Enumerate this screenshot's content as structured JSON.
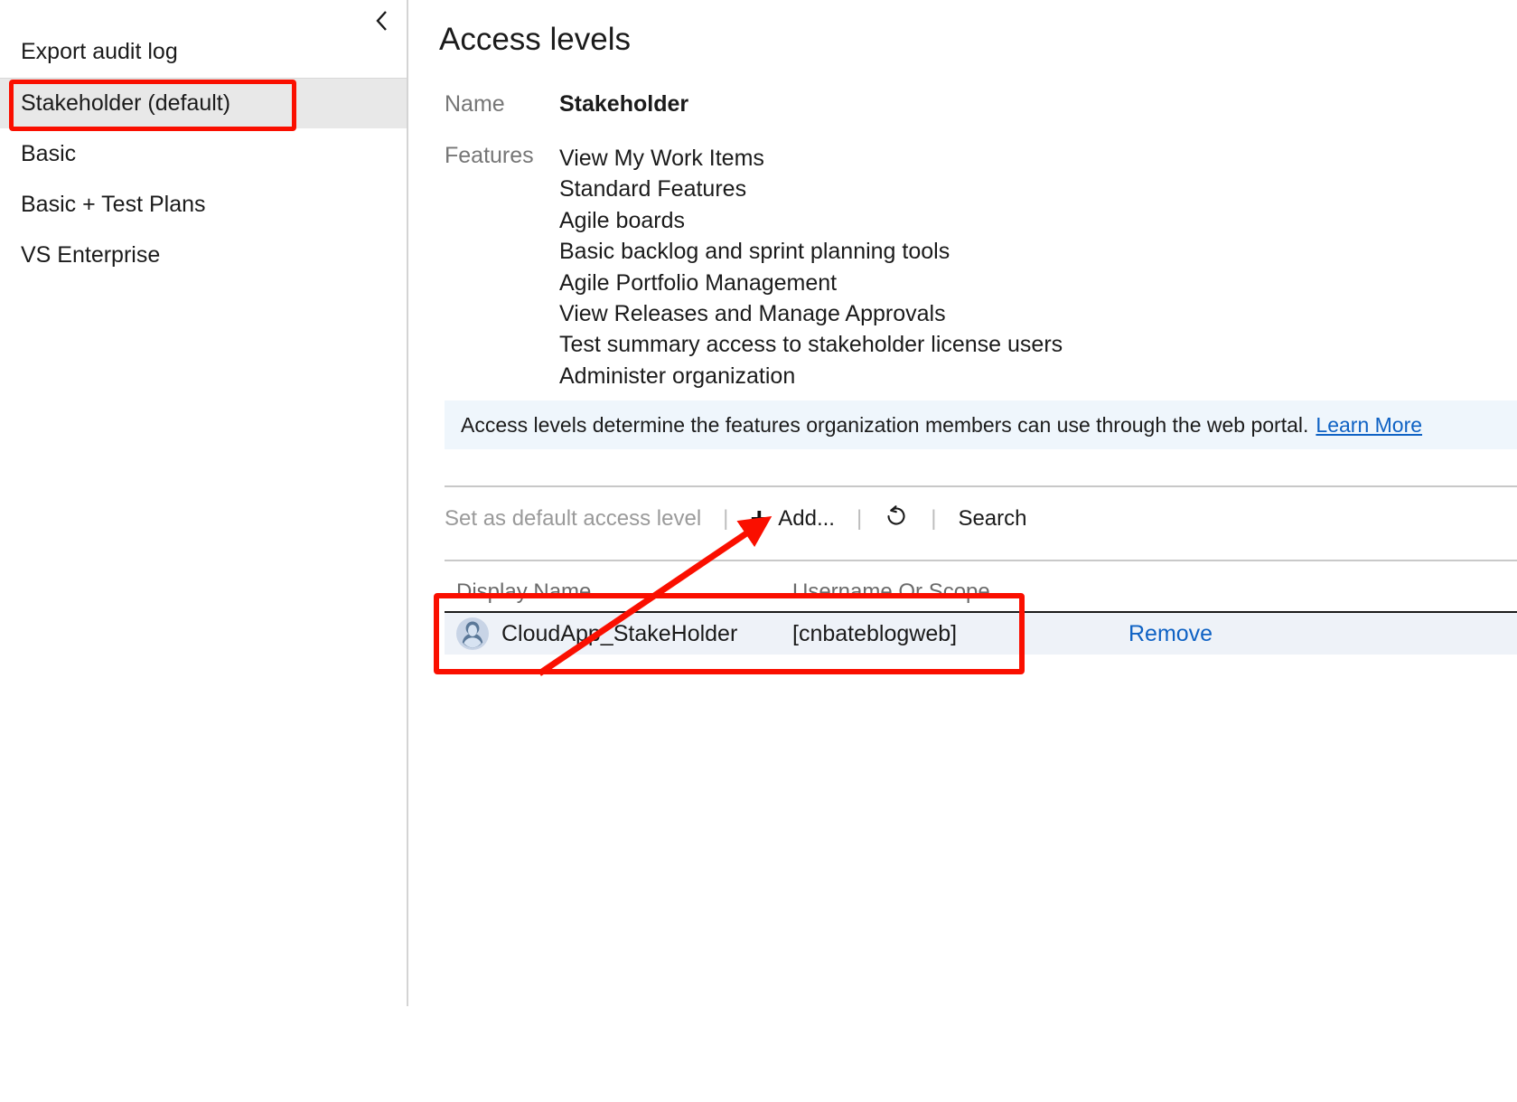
{
  "sidebar": {
    "collapse_icon": "chevron-left-icon",
    "export_item": {
      "label": "Export audit log"
    },
    "items": [
      {
        "label": "Stakeholder (default)",
        "selected": true
      },
      {
        "label": "Basic",
        "selected": false
      },
      {
        "label": "Basic + Test Plans",
        "selected": false
      },
      {
        "label": "VS Enterprise",
        "selected": false
      }
    ]
  },
  "main": {
    "title": "Access levels",
    "name_label": "Name",
    "name_value": "Stakeholder",
    "features_label": "Features",
    "features": [
      "View My Work Items",
      "Standard Features",
      "Agile boards",
      "Basic backlog and sprint planning tools",
      "Agile Portfolio Management",
      "View Releases and Manage Approvals",
      "Test summary access to stakeholder license users",
      "Administer organization"
    ],
    "banner": {
      "text": "Access levels determine the features organization members can use through the web portal.",
      "link_label": "Learn More"
    },
    "toolbar": {
      "set_default_label": "Set as default access level",
      "separator": "|",
      "add_label": "Add...",
      "add_icon": "plus-icon",
      "refresh_icon": "refresh-icon",
      "search_label": "Search"
    },
    "table": {
      "columns": [
        "Display Name",
        "Username Or Scope"
      ],
      "action_label": "Remove",
      "rows": [
        {
          "avatar": "user-avatar-icon",
          "display_name": "CloudApp_StakeHolder",
          "username_or_scope": "[cnbateblogweb]",
          "action": "Remove"
        }
      ]
    }
  },
  "annotations": {
    "highlight_color": "#fa0f00",
    "sidebar_highlight_target": "Stakeholder (default)",
    "row_highlight_target": "CloudApp_StakeHolder",
    "arrow_from": "table-row",
    "arrow_to": "add-button"
  },
  "colors": {
    "accent_link": "#0f62c4",
    "banner_bg": "#eff6fc",
    "row_bg": "#eef2f8",
    "selected_nav_bg": "#e8e8e8"
  }
}
